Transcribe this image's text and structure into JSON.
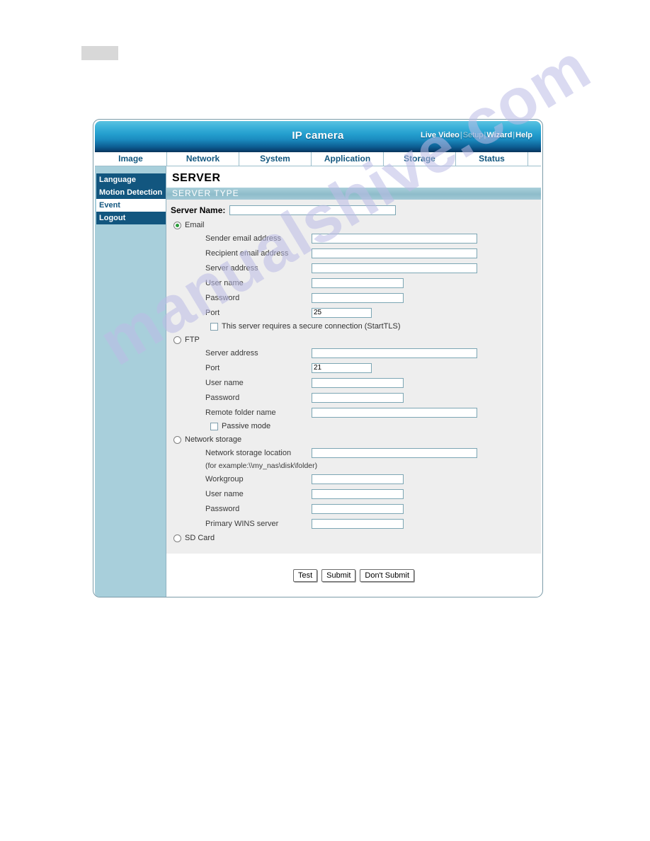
{
  "header": {
    "app_title": "IP camera",
    "links": [
      {
        "label": "Live Video",
        "state": "normal"
      },
      {
        "label": "Setup",
        "state": "dim"
      },
      {
        "label": "Wizard",
        "state": "normal"
      },
      {
        "label": "Help",
        "state": "normal"
      }
    ],
    "separator": "|"
  },
  "nav_tabs": [
    {
      "label": "Image"
    },
    {
      "label": "Network"
    },
    {
      "label": "System"
    },
    {
      "label": "Application"
    },
    {
      "label": "Storage"
    },
    {
      "label": "Status"
    }
  ],
  "sidebar": {
    "items": [
      {
        "label": "Language",
        "active": false
      },
      {
        "label": "Motion Detection",
        "active": false
      },
      {
        "label": "Event",
        "active": true
      },
      {
        "label": "Logout",
        "active": false
      }
    ]
  },
  "content": {
    "page_title": "SERVER",
    "section_bar": "SERVER TYPE",
    "server_name_label": "Server Name:",
    "server_name_value": "",
    "options": [
      {
        "name": "email",
        "label": "Email",
        "selected": true,
        "fields": [
          {
            "label": "Sender email address",
            "value": "",
            "size": "long"
          },
          {
            "label": "Recipient email address",
            "value": "",
            "size": "long"
          },
          {
            "label": "Server address",
            "value": "",
            "size": "long"
          },
          {
            "label": "User name",
            "value": "",
            "size": "med"
          },
          {
            "label": "Password",
            "value": "",
            "size": "med"
          },
          {
            "label": "Port",
            "value": "25",
            "size": "short"
          }
        ],
        "checkbox": {
          "label": "This server requires a secure connection (StartTLS)",
          "checked": false
        }
      },
      {
        "name": "ftp",
        "label": "FTP",
        "selected": false,
        "fields": [
          {
            "label": "Server address",
            "value": "",
            "size": "long"
          },
          {
            "label": "Port",
            "value": "21",
            "size": "short"
          },
          {
            "label": "User name",
            "value": "",
            "size": "med"
          },
          {
            "label": "Password",
            "value": "",
            "size": "med"
          },
          {
            "label": "Remote folder name",
            "value": "",
            "size": "long"
          }
        ],
        "checkbox": {
          "label": "Passive mode",
          "checked": false
        }
      },
      {
        "name": "network-storage",
        "label": "Network storage",
        "selected": false,
        "fields": [
          {
            "label": "Network storage location",
            "value": "",
            "size": "long"
          },
          {
            "label": "Workgroup",
            "value": "",
            "size": "med"
          },
          {
            "label": "User name",
            "value": "",
            "size": "med"
          },
          {
            "label": "Password",
            "value": "",
            "size": "med"
          },
          {
            "label": "Primary WINS server",
            "value": "",
            "size": "med"
          }
        ],
        "hint": "(for example:\\\\my_nas\\disk\\folder)"
      },
      {
        "name": "sd-card",
        "label": "SD Card",
        "selected": false,
        "fields": []
      }
    ],
    "buttons": [
      {
        "label": "Test"
      },
      {
        "label": "Submit"
      },
      {
        "label": "Don't Submit"
      }
    ]
  },
  "watermark": {
    "text": "manualshive.com"
  },
  "colors": {
    "header_gradient_top": "#5cc3e0",
    "header_gradient_bottom": "#09406f",
    "sidebar_blue": "#12567f",
    "body_blue": "#a8cfdb",
    "section_bar": "#8ebcca",
    "form_background": "#eeeeee",
    "input_border": "#7ca6b4",
    "radio_dot_green": "#2a9c3a",
    "watermark": "#bcbce6",
    "gray_block": "#d8d8d8"
  }
}
